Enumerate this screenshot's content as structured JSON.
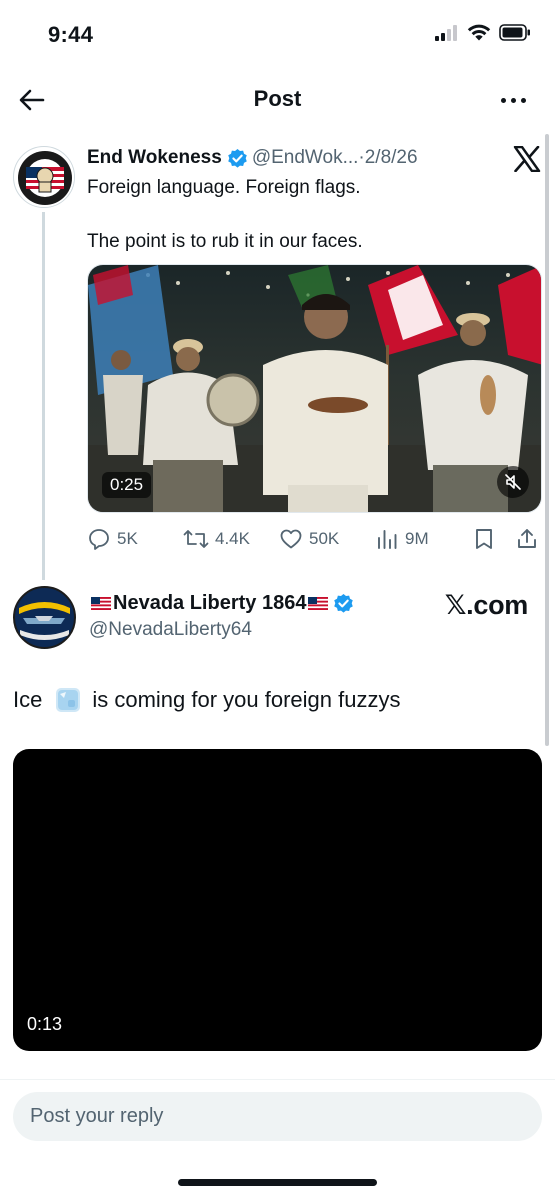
{
  "status_bar": {
    "time": "9:44",
    "icons": [
      "cellular-signal-icon",
      "wifi-icon",
      "battery-icon"
    ]
  },
  "nav": {
    "title": "Post",
    "back_icon": "back-arrow-icon",
    "more_icon": "more-options-icon"
  },
  "tweet": {
    "display_name": "End Wokeness",
    "handle": "@EndWok...",
    "date": "·2/8/26",
    "verified": true,
    "avatar_icon": "patch-avatar-icon",
    "text_lines": [
      "Foreign language. Foreign flags.",
      "The point is to rub it in our faces."
    ],
    "media": {
      "duration": "0:25",
      "muted_icon": "muted-speaker-icon"
    },
    "stats": {
      "replies": "5K",
      "reposts": "4.4K",
      "likes": "50K",
      "views": "9M"
    }
  },
  "quoted_post": {
    "display_name": "Nevada Liberty 1864",
    "handle": "@NevadaLiberty64",
    "source_label": "𝕏.com",
    "verified": true,
    "text_before_emoji": "Ice",
    "emoji": "ice-cube-icon",
    "text_after_emoji": "is coming for you foreign fuzzys",
    "media": {
      "duration": "0:13"
    }
  },
  "reply": {
    "placeholder": "Post your reply"
  },
  "colors": {
    "text_primary": "#0f1419",
    "text_secondary": "#536471",
    "verified_blue": "#1d9bf0",
    "divider": "#eff3f4"
  }
}
